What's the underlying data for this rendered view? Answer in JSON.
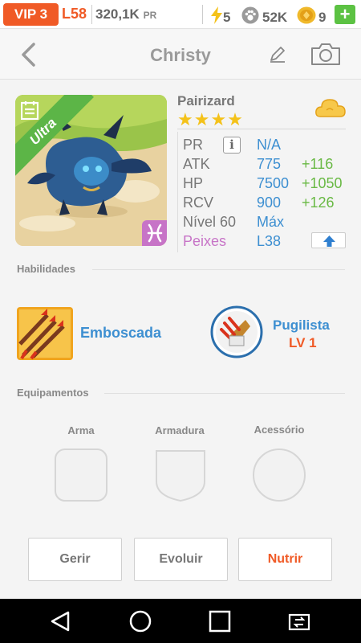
{
  "topbar": {
    "vip": "VIP 3",
    "level": "L58",
    "power": "320,1K",
    "power_unit": "PR",
    "energy": "5",
    "paws": "52K",
    "coins": "9",
    "plus": "+"
  },
  "header": {
    "title": "Christy"
  },
  "pet": {
    "rarity_badge": "Ultra",
    "species": "Pairizard",
    "stars": "★★★★",
    "stats": {
      "pr_label": "PR",
      "pr_value": "N/A",
      "atk_label": "ATK",
      "atk_value": "775",
      "atk_bonus": "+116",
      "hp_label": "HP",
      "hp_value": "7500",
      "hp_bonus": "+1050",
      "rcv_label": "RCV",
      "rcv_value": "900",
      "rcv_bonus": "+126",
      "level_label": "Nível 60",
      "level_value": "Máx",
      "sign_label": "Peixes",
      "sign_value": "L38"
    }
  },
  "skills": {
    "heading": "Habilidades",
    "skill1_name": "Emboscada",
    "skill2_name": "Pugilista",
    "skill2_level": "LV 1"
  },
  "equipment": {
    "heading": "Equipamentos",
    "weapon": "Arma",
    "armor": "Armadura",
    "accessory": "Acessório"
  },
  "actions": {
    "manage": "Gerir",
    "evolve": "Evoluir",
    "feed": "Nutrir"
  },
  "colors": {
    "accent_orange": "#f05a26",
    "link_blue": "#3d8fd1",
    "bonus_green": "#69b944",
    "star_gold": "#f4c21a",
    "zodiac_pink": "#c774c7"
  }
}
